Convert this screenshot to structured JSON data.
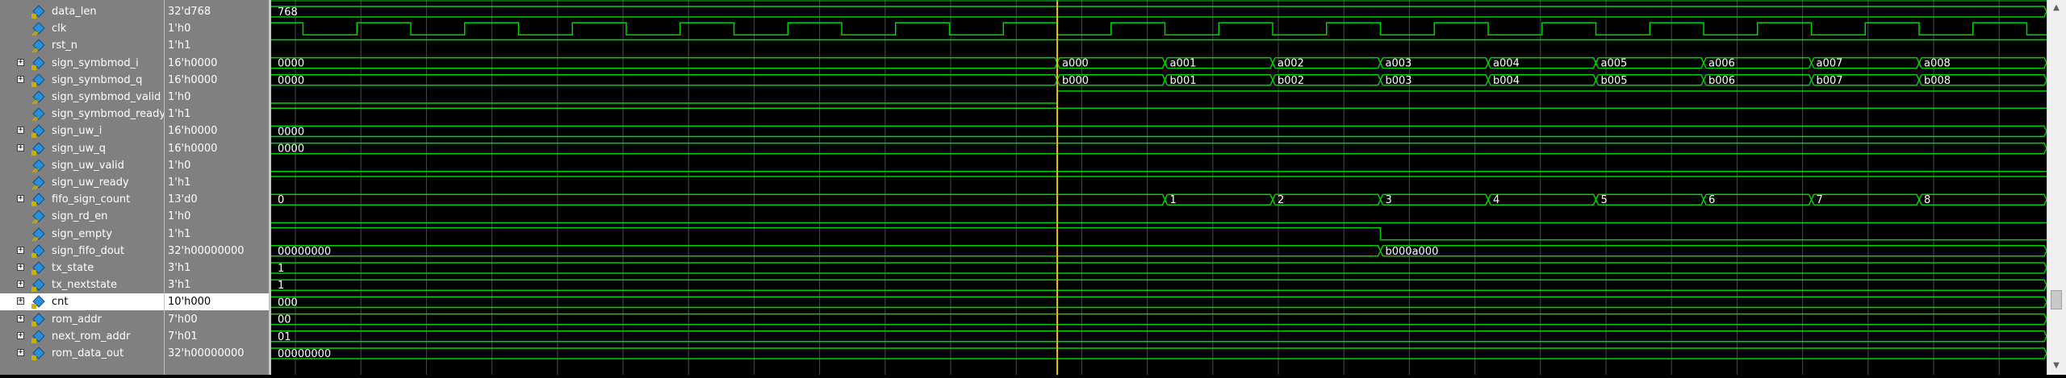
{
  "signals": [
    {
      "name": "data_len",
      "value": "32'd768",
      "expand": false,
      "icon": "bus",
      "wave": {
        "type": "bus",
        "segments": [
          {
            "label": "768"
          }
        ]
      }
    },
    {
      "name": "clk",
      "value": "1'h0",
      "expand": false,
      "icon": "bit",
      "wave": {
        "type": "clock"
      }
    },
    {
      "name": "rst_n",
      "value": "1'h1",
      "expand": false,
      "icon": "bit",
      "wave": {
        "type": "bit",
        "level": "high"
      }
    },
    {
      "name": "sign_symbmod_i",
      "value": "16'h0000",
      "expand": true,
      "icon": "bus",
      "wave": {
        "type": "bus",
        "segments": [
          {
            "label": "0000"
          },
          {
            "label": "a000"
          },
          {
            "label": "a001"
          },
          {
            "label": "a002"
          },
          {
            "label": "a003"
          },
          {
            "label": "a004"
          },
          {
            "label": "a005"
          },
          {
            "label": "a006"
          },
          {
            "label": "a007"
          },
          {
            "label": "a008"
          }
        ]
      }
    },
    {
      "name": "sign_symbmod_q",
      "value": "16'h0000",
      "expand": true,
      "icon": "bus",
      "wave": {
        "type": "bus",
        "segments": [
          {
            "label": "0000"
          },
          {
            "label": "b000"
          },
          {
            "label": "b001"
          },
          {
            "label": "b002"
          },
          {
            "label": "b003"
          },
          {
            "label": "b004"
          },
          {
            "label": "b005"
          },
          {
            "label": "b006"
          },
          {
            "label": "b007"
          },
          {
            "label": "b008"
          }
        ]
      }
    },
    {
      "name": "sign_symbmod_valid",
      "value": "1'h0",
      "expand": false,
      "icon": "bit",
      "wave": {
        "type": "bit",
        "level": "low-then-high"
      }
    },
    {
      "name": "sign_symbmod_ready",
      "value": "1'h1",
      "expand": false,
      "icon": "bit",
      "wave": {
        "type": "bit",
        "level": "high"
      }
    },
    {
      "name": "sign_uw_i",
      "value": "16'h0000",
      "expand": true,
      "icon": "bus",
      "wave": {
        "type": "bus",
        "segments": [
          {
            "label": "0000"
          }
        ]
      }
    },
    {
      "name": "sign_uw_q",
      "value": "16'h0000",
      "expand": true,
      "icon": "bus",
      "wave": {
        "type": "bus",
        "segments": [
          {
            "label": "0000"
          }
        ]
      }
    },
    {
      "name": "sign_uw_valid",
      "value": "1'h0",
      "expand": false,
      "icon": "bit",
      "wave": {
        "type": "bit",
        "level": "low"
      }
    },
    {
      "name": "sign_uw_ready",
      "value": "1'h1",
      "expand": false,
      "icon": "bit",
      "wave": {
        "type": "bit",
        "level": "high"
      }
    },
    {
      "name": "fifo_sign_count",
      "value": "13'd0",
      "expand": true,
      "icon": "bus",
      "wave": {
        "type": "bus",
        "segments": [
          {
            "label": "0"
          },
          {
            "label": "1"
          },
          {
            "label": "2"
          },
          {
            "label": "3"
          },
          {
            "label": "4"
          },
          {
            "label": "5"
          },
          {
            "label": "6"
          },
          {
            "label": "7"
          },
          {
            "label": "8"
          }
        ]
      }
    },
    {
      "name": "sign_rd_en",
      "value": "1'h0",
      "expand": false,
      "icon": "bit",
      "wave": {
        "type": "bit",
        "level": "low"
      }
    },
    {
      "name": "sign_empty",
      "value": "1'h1",
      "expand": false,
      "icon": "bit",
      "wave": {
        "type": "bit",
        "level": "high-then-low"
      }
    },
    {
      "name": "sign_fifo_dout",
      "value": "32'h00000000",
      "expand": true,
      "icon": "bus",
      "wave": {
        "type": "bus",
        "segments": [
          {
            "label": "00000000"
          },
          {
            "label": "b000a000"
          }
        ]
      }
    },
    {
      "name": "tx_state",
      "value": "3'h1",
      "expand": true,
      "icon": "bus",
      "wave": {
        "type": "bus",
        "segments": [
          {
            "label": "1"
          }
        ]
      }
    },
    {
      "name": "tx_nextstate",
      "value": "3'h1",
      "expand": true,
      "icon": "bus",
      "wave": {
        "type": "bus",
        "segments": [
          {
            "label": "1"
          }
        ]
      }
    },
    {
      "name": "cnt",
      "value": "10'h000",
      "expand": true,
      "icon": "bus",
      "selected": true,
      "wave": {
        "type": "bus",
        "segments": [
          {
            "label": "000"
          }
        ]
      }
    },
    {
      "name": "rom_addr",
      "value": "7'h00",
      "expand": true,
      "icon": "bus",
      "wave": {
        "type": "bus",
        "segments": [
          {
            "label": "00"
          }
        ]
      }
    },
    {
      "name": "next_rom_addr",
      "value": "7'h01",
      "expand": true,
      "icon": "bus",
      "wave": {
        "type": "bus",
        "segments": [
          {
            "label": "01"
          }
        ]
      }
    },
    {
      "name": "rom_data_out",
      "value": "32'h00000000",
      "expand": true,
      "icon": "bus",
      "wave": {
        "type": "bus",
        "segments": [
          {
            "label": "00000000"
          }
        ]
      }
    }
  ],
  "colors": {
    "wave": "#00d000",
    "cursor": "#e0c000",
    "grid": "#4a4a4a",
    "panel": "#808080",
    "icon": "#2a8fd8"
  },
  "scrollbar": {
    "up_icon": "triangle-up",
    "down_icon": "triangle-down"
  }
}
